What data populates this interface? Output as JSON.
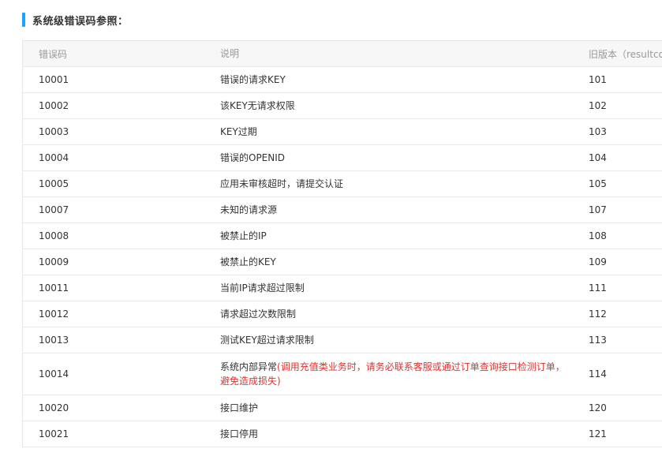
{
  "section": {
    "title": "系统级错误码参照："
  },
  "table": {
    "headers": [
      "错误码",
      "说明",
      "旧版本（resultcode）"
    ],
    "rows": [
      {
        "code": "10001",
        "desc": "错误的请求KEY",
        "old": "101"
      },
      {
        "code": "10002",
        "desc": "该KEY无请求权限",
        "old": "102"
      },
      {
        "code": "10003",
        "desc": "KEY过期",
        "old": "103"
      },
      {
        "code": "10004",
        "desc": "错误的OPENID",
        "old": "104"
      },
      {
        "code": "10005",
        "desc": "应用未审核超时，请提交认证",
        "old": "105"
      },
      {
        "code": "10007",
        "desc": "未知的请求源",
        "old": "107"
      },
      {
        "code": "10008",
        "desc": "被禁止的IP",
        "old": "108"
      },
      {
        "code": "10009",
        "desc": "被禁止的KEY",
        "old": "109"
      },
      {
        "code": "10011",
        "desc": "当前IP请求超过限制",
        "old": "111"
      },
      {
        "code": "10012",
        "desc": "请求超过次数限制",
        "old": "112"
      },
      {
        "code": "10013",
        "desc": "测试KEY超过请求限制",
        "old": "113"
      },
      {
        "code": "10014",
        "desc": "系统内部异常",
        "desc_warning": "(调用充值类业务时，请务必联系客服或通过订单查询接口检测订单，避免造成损失)",
        "old": "114"
      },
      {
        "code": "10020",
        "desc": "接口维护",
        "old": "120"
      },
      {
        "code": "10021",
        "desc": "接口停用",
        "old": "121"
      }
    ]
  },
  "colors": {
    "accent_bar": "#1aa3ff",
    "warning_text": "#e0322f",
    "header_bg": "#f7f7f7"
  }
}
